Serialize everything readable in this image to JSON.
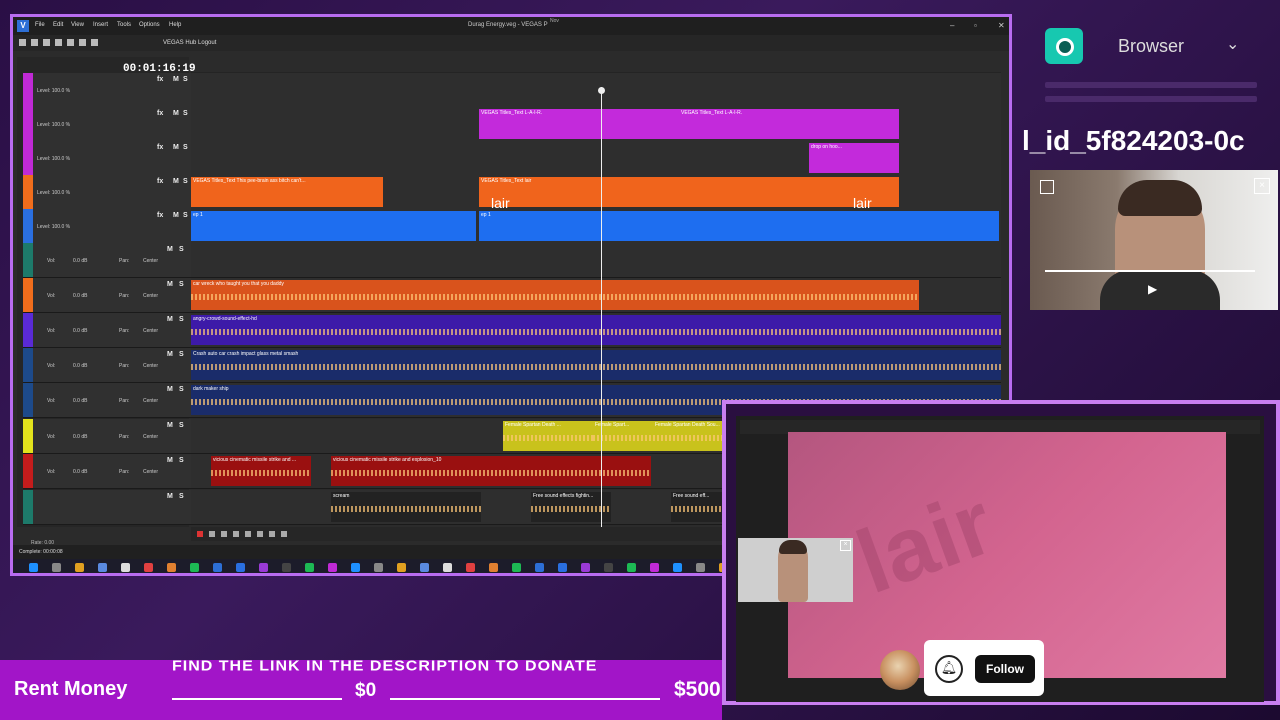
{
  "window": {
    "title": "Durag Energy.veg - VEGAS P",
    "menu": [
      "File",
      "Edit",
      "View",
      "Insert",
      "Tools",
      "Options",
      "Help"
    ],
    "hub_label": "VEGAS Hub Logout",
    "top_note": "Nov"
  },
  "timeline": {
    "timecode": "00:01:16:19",
    "video_tracks": [
      {
        "color": "#c02ad6",
        "level": "Level: 100.0 %",
        "clips": []
      },
      {
        "color": "#c02ad6",
        "level": "Level: 100.0 %",
        "clips": [
          {
            "label": "VEGAS Titles_Text L-A-I-R.",
            "color": "#c32adb"
          },
          {
            "label": "VEGAS Titles_Text L-A-I-R.",
            "color": "#c32adb"
          }
        ]
      },
      {
        "color": "#c02ad6",
        "level": "Level: 100.0 %",
        "clips": [
          {
            "label": "drop on hoo...",
            "color": "#c32adb"
          }
        ]
      },
      {
        "color": "#f06d1c",
        "level": "Level: 100.0 %",
        "clips": [
          {
            "label": "VEGAS Titles_Text This pee-brain ass bitch can't...",
            "color": "#f0641c"
          },
          {
            "label": "VEGAS Titles_Text lair",
            "color": "#f0641c"
          }
        ]
      },
      {
        "color": "#2a6fe0",
        "level": "Level: 100.0 %",
        "clips": [
          {
            "label": "ep 1",
            "color": "#1e6ef0"
          },
          {
            "label": "ep 1",
            "color": "#1e6ef0"
          },
          {
            "label": "ep 1",
            "color": "#1e6ef0"
          }
        ]
      }
    ],
    "lair_word": "lair",
    "audio_tracks": [
      {
        "color": "#1d7a6a",
        "vol": "0.0 dB",
        "pan": "Center",
        "clips": []
      },
      {
        "color": "#f06d1c",
        "vol": "0.0 dB",
        "pan": "Center",
        "clips": [
          {
            "label": "car wreck who taught you that you daddy",
            "color": "#d9531c"
          }
        ]
      },
      {
        "color": "#5a2ad6",
        "vol": "0.0 dB",
        "pan": "Center",
        "clips": [
          {
            "label": "angry-crowd-sound-effect-hd",
            "color": "#3d1aa8"
          }
        ]
      },
      {
        "color": "#1d4a8a",
        "vol": "0.0 dB",
        "pan": "Center",
        "clips": [
          {
            "label": "Crash auto car crash impact glass metal smash",
            "color": "#1a2c6a"
          }
        ]
      },
      {
        "color": "#1d4a8a",
        "vol": "0.0 dB",
        "pan": "Center",
        "clips": [
          {
            "label": "dark maker ship",
            "color": "#1a2c6a"
          }
        ]
      },
      {
        "color": "#e3e31c",
        "vol": "0.0 dB",
        "pan": "Center",
        "clips": [
          {
            "label": "Female Spartan Death ...",
            "color": "#c9c21c"
          },
          {
            "label": "Female Spart...",
            "color": "#c9c21c"
          },
          {
            "label": "Female Spartan Death Sou...",
            "color": "#c9c21c"
          }
        ]
      },
      {
        "color": "#c41c1c",
        "vol": "0.0 dB",
        "pan": "Center",
        "clips": [
          {
            "label": "vicious cinematic missile strike and ...",
            "color": "#9a1010"
          },
          {
            "label": "vicious cinematic missile strike and explosion_10",
            "color": "#9a1010"
          }
        ]
      },
      {
        "color": "#1d7a6a",
        "vol": "",
        "pan": "",
        "clips": [
          {
            "label": "scream",
            "color": "#222"
          },
          {
            "label": "Free sound effects  fightin...",
            "color": "#222"
          },
          {
            "label": "Free sound eff...",
            "color": "#222"
          }
        ]
      }
    ],
    "vol_label": "Vol:",
    "pan_label": "Pan:",
    "m_label": "M",
    "s_label": "S",
    "fx_label": "fx",
    "rate": "Rate: 0.00",
    "status": "Complete: 00:00:08"
  },
  "right_panel": {
    "browser_label": "Browser",
    "id_text": "l_id_5f824203-0c"
  },
  "follow": {
    "label": "Follow"
  },
  "donation": {
    "label": "Rent Money",
    "ticker": "FIND THE LINK IN THE DESCRIPTION TO DONATE",
    "current": "$0",
    "goal": "$500"
  },
  "colors": {
    "accent": "#b86cf0",
    "donation_bg": "#a215c8",
    "browser_icon": "#17c8b0"
  }
}
